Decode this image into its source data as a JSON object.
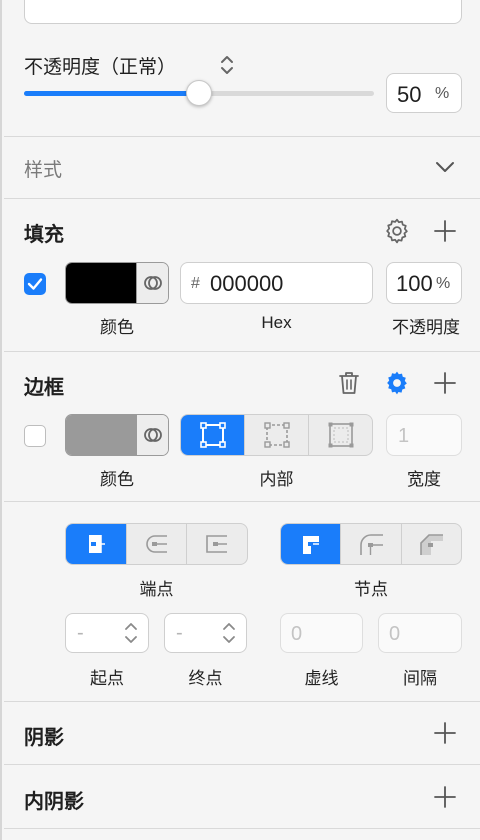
{
  "opacity": {
    "title": "不透明度（正常）",
    "value": 50,
    "input_value": "50",
    "unit": "%"
  },
  "style_section": {
    "title": "样式"
  },
  "fill": {
    "title": "填充",
    "enabled": true,
    "color_hex": "#000000",
    "hex_prefix": "#",
    "hex_value": "000000",
    "opacity_value": "100",
    "opacity_unit": "%",
    "labels": {
      "color": "颜色",
      "hex": "Hex",
      "opacity": "不透明度"
    }
  },
  "border": {
    "title": "边框",
    "enabled": false,
    "color_hex": "#9a9a9a",
    "position": "内部",
    "width_placeholder": "1",
    "labels": {
      "color": "颜色",
      "position": "内部",
      "width": "宽度"
    },
    "endpoint_label": "端点",
    "node_label": "节点",
    "start_value": "-",
    "end_value": "-",
    "dash_value": "0",
    "gap_value": "0",
    "field_labels": {
      "start": "起点",
      "end": "终点",
      "dash": "虚线",
      "gap": "间隔"
    }
  },
  "shadow": {
    "title": "阴影"
  },
  "inner_shadow": {
    "title": "内阴影"
  },
  "colors": {
    "accent": "#1a7dfa"
  }
}
